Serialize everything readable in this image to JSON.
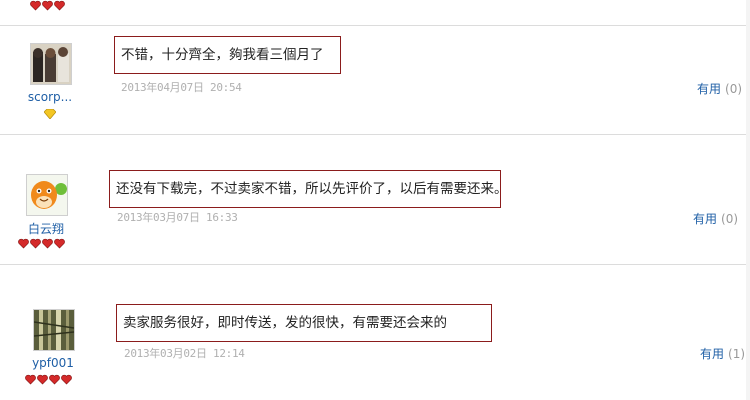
{
  "top_partial": {
    "badge": "heart-badges",
    "count": 3
  },
  "reviews": [
    {
      "username": "scorp...",
      "avatar": "band-photo",
      "badge": "diamond-badge",
      "comment": "不错，十分齊全，夠我看三個月了",
      "timestamp": "2013年04月07日 20:54",
      "useful_label": "有用",
      "useful_count": "(0)"
    },
    {
      "username": "白云翔",
      "avatar": "orange-cartoon",
      "badge": "heart-badges",
      "badge_count": 4,
      "comment": "还没有下载完，不过卖家不错，所以先评价了，以后有需要还来。",
      "timestamp": "2013年03月07日 16:33",
      "useful_label": "有用",
      "useful_count": "(0)"
    },
    {
      "username": "ypf001",
      "avatar": "bamboo",
      "badge": "heart-badges",
      "badge_count": 4,
      "comment": "卖家服务很好，即时传送，发的很快，有需要还会来的",
      "timestamp": "2013年03月02日 12:14",
      "useful_label": "有用",
      "useful_count": "(1)"
    }
  ],
  "colors": {
    "border": "#8b1c1c",
    "link": "#1f5fa6",
    "muted": "#b0b0b0",
    "heart": "#d42a2a"
  }
}
